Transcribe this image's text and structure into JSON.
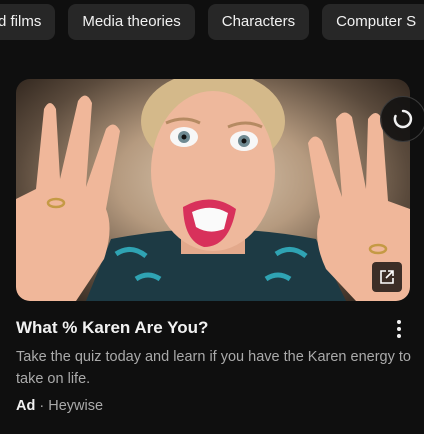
{
  "chips": [
    "d films",
    "Media theories",
    "Characters",
    "Computer S"
  ],
  "ad": {
    "title": "What % Karen Are You?",
    "description": "Take the quiz today and learn if you have the Karen energy to take on life.",
    "ad_label": "Ad",
    "separator": "·",
    "advertiser": "Heywise"
  },
  "icons": {
    "loading": "loading-spinner-icon",
    "external": "open-external-icon",
    "more": "more-vert-icon"
  },
  "colors": {
    "background": "#0f0f0f",
    "chip_bg": "#272727",
    "text_primary": "#f1f1f1",
    "text_secondary": "#aaaaaa"
  }
}
